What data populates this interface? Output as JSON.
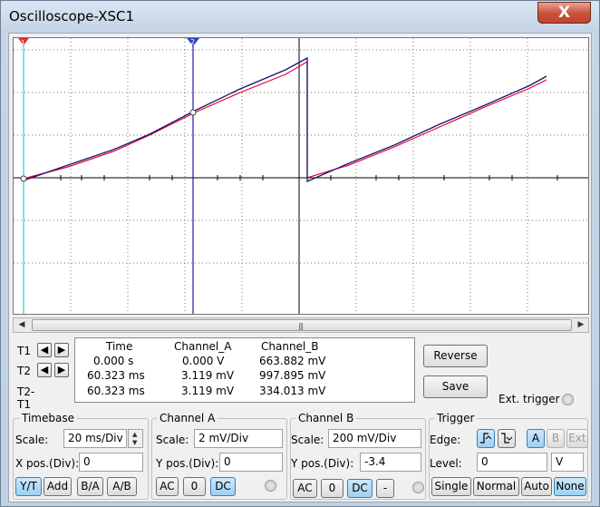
{
  "window": {
    "title": "Oscilloscope-XSC1",
    "close_label": "X"
  },
  "scope": {
    "cursor1_label": "1",
    "cursor2_label": "2",
    "colors": {
      "channel_a": "#e8003a",
      "channel_b": "#16166b",
      "cursor": "#1a1aa0",
      "axis_t": "#00c8c8"
    }
  },
  "scrollbar": {
    "left_icon": "◀",
    "right_icon": "▶",
    "grip": "|||"
  },
  "cursors": {
    "t1": "T1",
    "t2": "T2",
    "t2t1": "T2-T1",
    "left_icon": "◀",
    "right_icon": "▶"
  },
  "readout": {
    "headers": [
      "Time",
      "Channel_A",
      "Channel_B"
    ],
    "rows": [
      [
        "0.000 s",
        "0.000 V",
        "663.882 mV"
      ],
      [
        "60.323 ms",
        "3.119 mV",
        "997.895 mV"
      ],
      [
        "60.323 ms",
        "3.119 mV",
        "334.013 mV"
      ]
    ]
  },
  "actions": {
    "reverse": "Reverse",
    "save": "Save",
    "ext_trigger": "Ext. trigger"
  },
  "timebase": {
    "title": "Timebase",
    "scale_label": "Scale:",
    "scale_value": "20 ms/Div",
    "xpos_label": "X pos.(Div):",
    "xpos_value": "0",
    "modes": [
      "Y/T",
      "Add",
      "B/A",
      "A/B"
    ]
  },
  "channel_a": {
    "title": "Channel A",
    "scale_label": "Scale:",
    "scale_value": "2 mV/Div",
    "ypos_label": "Y pos.(Div):",
    "ypos_value": "0",
    "coupling": [
      "AC",
      "0",
      "DC"
    ]
  },
  "channel_b": {
    "title": "Channel B",
    "scale_label": "Scale:",
    "scale_value": "200 mV/Div",
    "ypos_label": "Y pos.(Div):",
    "ypos_value": "-3.4",
    "coupling": [
      "AC",
      "0",
      "DC",
      "-"
    ]
  },
  "trigger": {
    "title": "Trigger",
    "edge_label": "Edge:",
    "level_label": "Level:",
    "level_value": "0",
    "level_unit": "V",
    "sources": [
      "A",
      "B",
      "Ext"
    ],
    "modes": [
      "Single",
      "Normal",
      "Auto",
      "None"
    ]
  }
}
